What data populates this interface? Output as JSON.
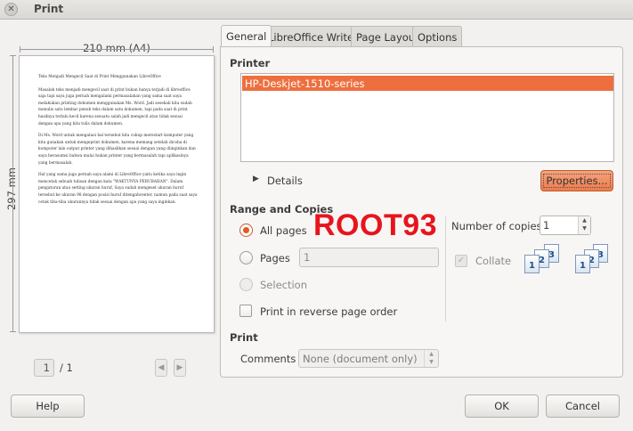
{
  "window": {
    "title": "Print"
  },
  "preview": {
    "paper_width": "210 mm (A4)",
    "paper_height": "297 mm",
    "document": {
      "title": "Teks Menjadi Mengecil Saat di Print Menggunakan LibreOffice",
      "paragraphs": [
        "Masalah teks menjadi mengecil saat di print bukan hanya terjadi di libreoffice saja tapi saya juga pernah mengalami permasalahan yang sama saat saya melakukan printing dokumen menggunakan Ms. Word. Jadi sesekali kita sudah menulis satu lembar penuh teks dalam satu dokumen, tapi pada saat di print hasilnya terlalu kecil karena sesuatu salah jadi mengecil atau tidak sesuai dengan apa yang kita tulis dalam dokumen.",
        "Di Ms. Word untuk mengatasi hal tersebut kita cukup merestart komputer yang kita gunakan untuk mengeprint dokumen, karena memang setelah dicoba di komputer lain output printer yang dihasilkan sesuai dengan yang diinginkan dan saya berasumsi bahwa mulai bukan printer yang bermasalah tapi aplikasinya yang bermasalah.",
        "Hal yang sama juga pernah saya alami di LibreOffice yaitu ketika saya ingin mencetak sebuah tulisan dengan kata \"WAKTUNYA PERUBAHAN\". Dalam pengaturan atau setting ukuran huruf, Saya sudah mengeset ukuran huruf tersebut ke ukuran 98 dengan posisi huruf ditengahcenter, namun pada saat saya cetak tiba-tiba ukurannya tidak sesuai dengan apa yang saya inginkan."
      ]
    },
    "page_current": "1",
    "page_total": "/ 1"
  },
  "tabs": [
    "General",
    "LibreOffice Writer",
    "Page Layout",
    "Options"
  ],
  "printer": {
    "section_title": "Printer",
    "list": [
      "HP-Deskjet-1510-series"
    ],
    "details_label": "Details",
    "properties_button": "Properties..."
  },
  "range": {
    "section_title": "Range and Copies",
    "all_pages": "All pages",
    "pages": "Pages",
    "pages_value": "1",
    "selection": "Selection",
    "reverse_label": "Print in reverse page order",
    "copies_label": "Number of copies",
    "copies_value": "1",
    "collate_label": "Collate",
    "collate_icon_numbers": [
      "1",
      "2",
      "3"
    ]
  },
  "print_section": {
    "section_title": "Print",
    "comments_label": "Comments",
    "comments_value": "None (document only)"
  },
  "watermark": "ROOT93",
  "buttons": {
    "help": "Help",
    "ok": "OK",
    "cancel": "Cancel"
  },
  "colors": {
    "accent": "#ee6f3e",
    "watermark": "#e8141d"
  }
}
